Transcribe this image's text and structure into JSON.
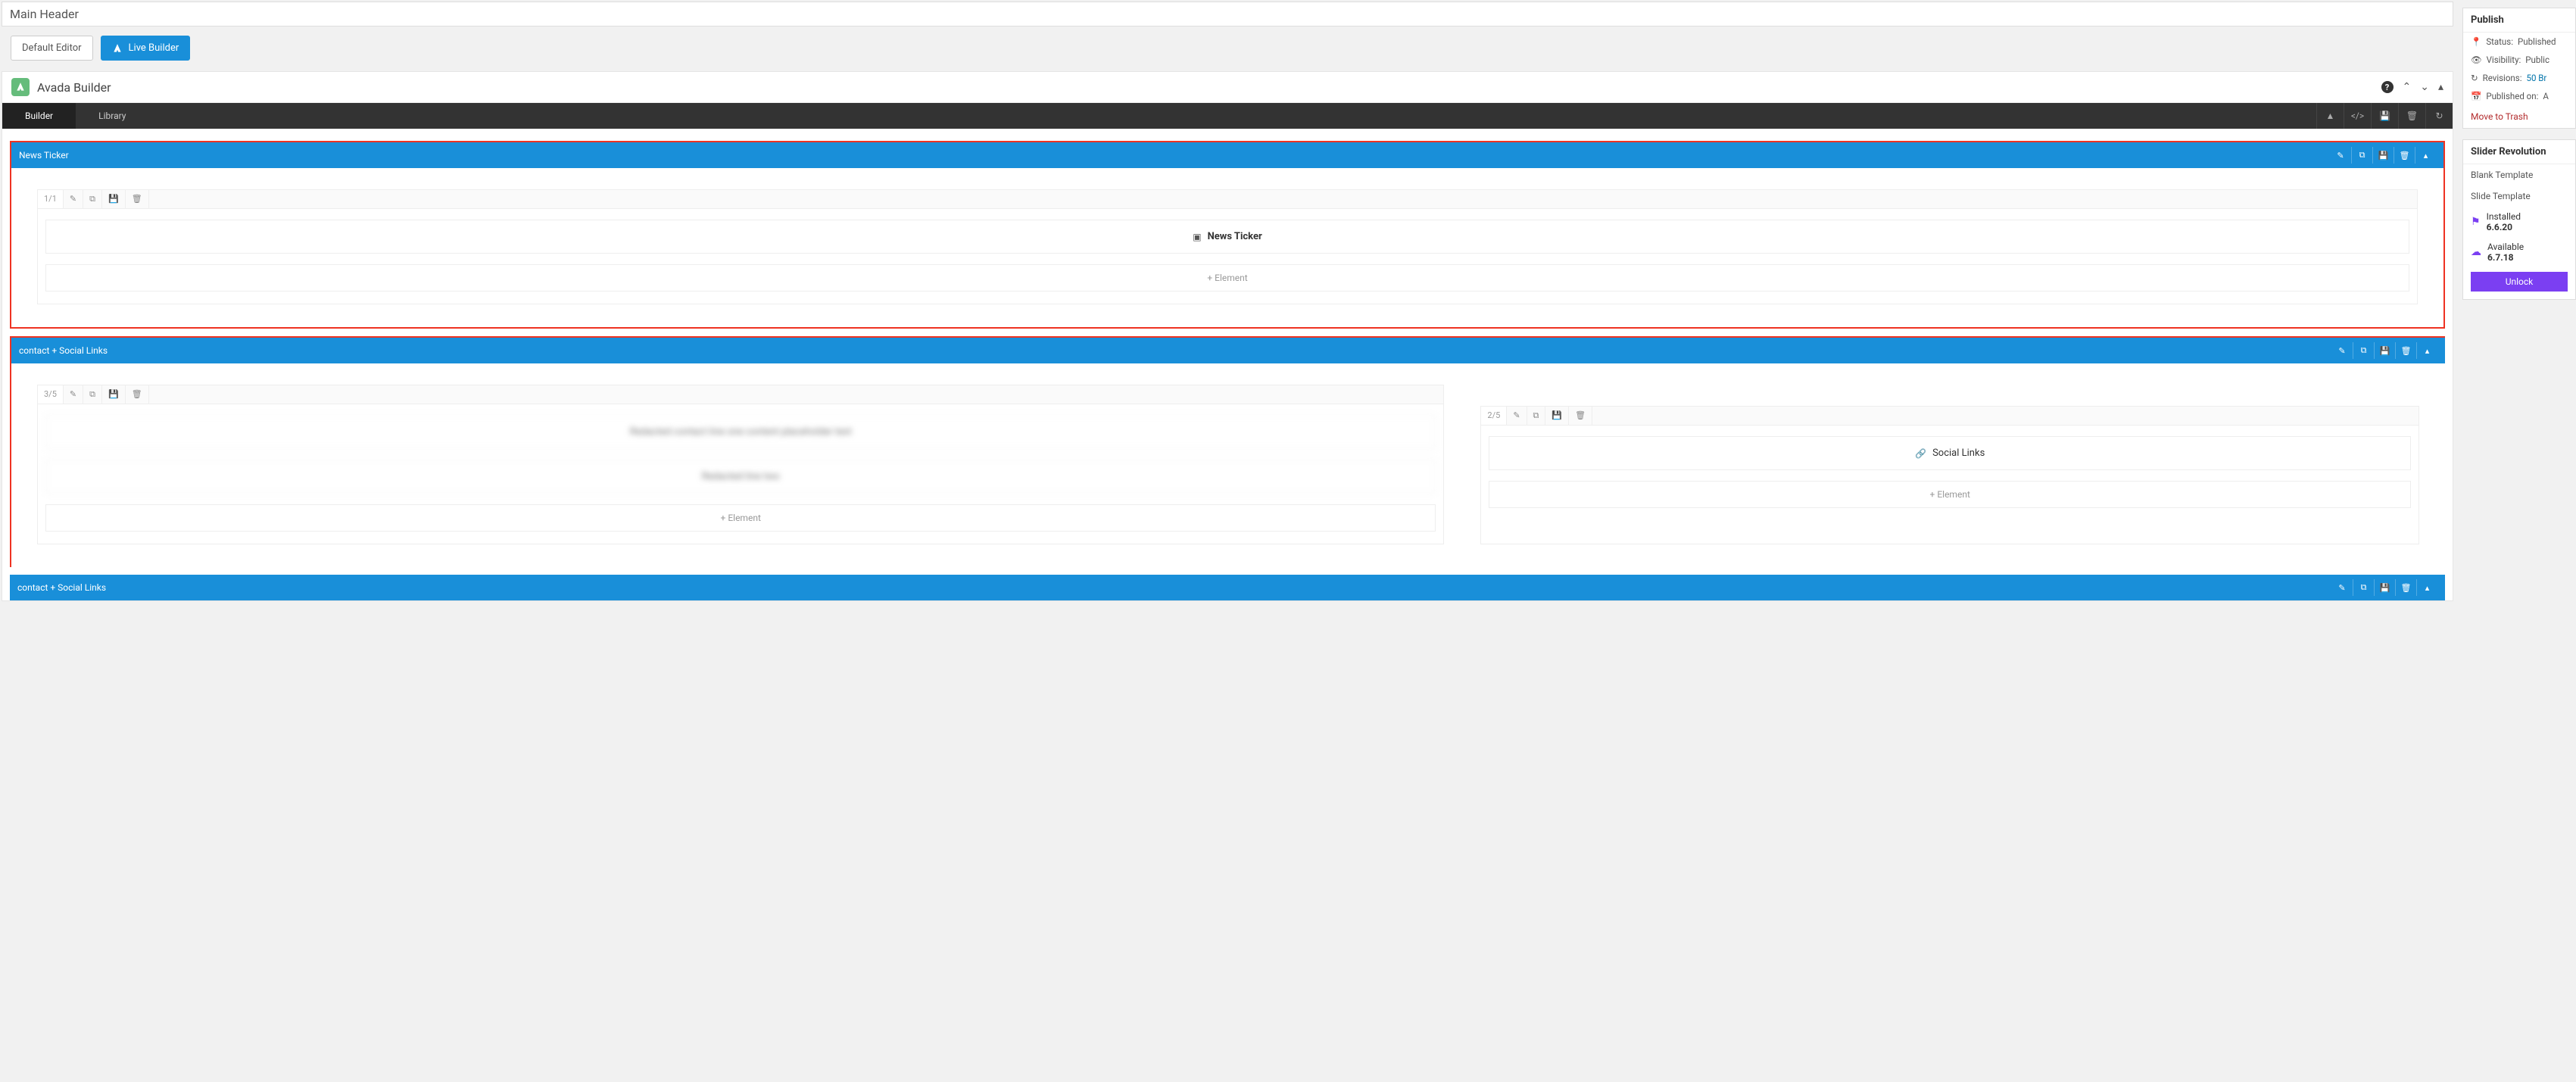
{
  "title_input": {
    "value": "Main Header"
  },
  "buttons": {
    "default_editor": "Default Editor",
    "live_builder": "Live Builder"
  },
  "builder": {
    "title": "Avada Builder",
    "tabs": {
      "builder": "Builder",
      "library": "Library"
    }
  },
  "containers": [
    {
      "title": "News Ticker",
      "columns": [
        {
          "fraction": "1/1",
          "elements": [
            {
              "type": "widget",
              "label": "News Ticker",
              "blurred": false,
              "icon": "newspaper"
            }
          ],
          "add_label": "Element"
        }
      ]
    },
    {
      "title": "contact + Social Links",
      "columns": [
        {
          "fraction": "3/5",
          "elements": [
            {
              "type": "text",
              "label": "Redacted contact line one content placeholder text",
              "blurred": true
            },
            {
              "type": "text",
              "label": "Redacted line two",
              "blurred": true
            }
          ],
          "add_label": "Element"
        },
        {
          "fraction": "2/5",
          "elements": [
            {
              "type": "social",
              "label": "Social Links",
              "blurred": false,
              "icon": "link"
            }
          ],
          "add_label": "Element"
        }
      ]
    }
  ],
  "bottom_bar": {
    "title": "contact + Social Links"
  },
  "sidebar": {
    "publish": {
      "header": "Publish",
      "status_label": "Status:",
      "status_value": "Published",
      "visibility_label": "Visibility:",
      "visibility_value": "Public",
      "revisions_label": "Revisions:",
      "revisions_value": "50 Br",
      "published_label": "Published on:",
      "published_value": "A",
      "trash": "Move to Trash"
    },
    "slider": {
      "header": "Slider Revolution",
      "items": [
        "Blank Template",
        "Slide Template"
      ],
      "installed_label": "Installed",
      "installed_version": "6.6.20",
      "available_label": "Available",
      "available_version": "6.7.18",
      "unlock": "Unlock"
    }
  }
}
